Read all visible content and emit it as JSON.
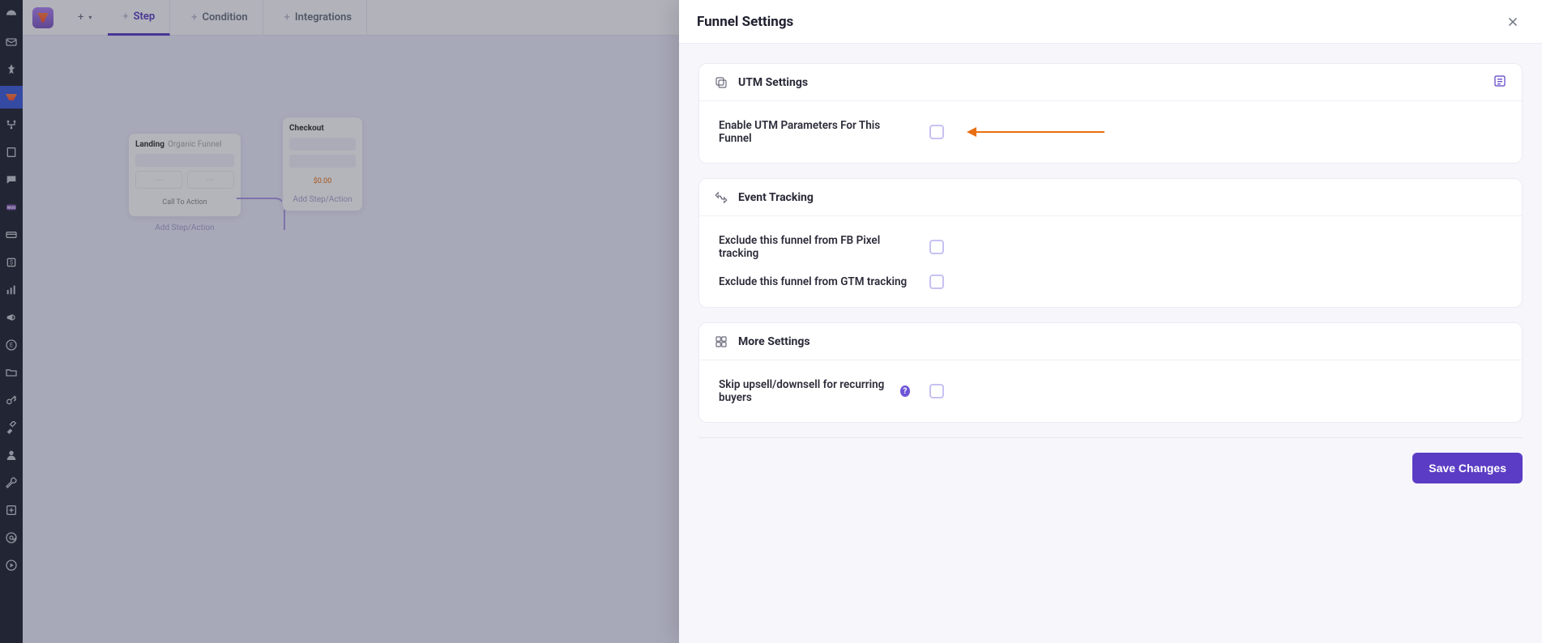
{
  "sidebar": {
    "items": [
      {
        "name": "dashboard-icon"
      },
      {
        "name": "mail-icon"
      },
      {
        "name": "pin-icon"
      },
      {
        "name": "funnel-icon",
        "active": true
      },
      {
        "name": "flow-icon"
      },
      {
        "name": "page-icon"
      },
      {
        "name": "chat-icon"
      },
      {
        "name": "woo-icon"
      },
      {
        "name": "card-icon"
      },
      {
        "name": "dollar-icon"
      },
      {
        "name": "barchart-icon"
      },
      {
        "name": "megaphone-icon"
      },
      {
        "name": "element-icon"
      },
      {
        "name": "folder-icon"
      },
      {
        "name": "key-icon"
      },
      {
        "name": "brush-icon"
      },
      {
        "name": "person-icon"
      },
      {
        "name": "wrench-icon"
      },
      {
        "name": "plus-box-icon"
      },
      {
        "name": "at-icon"
      },
      {
        "name": "play-icon"
      }
    ]
  },
  "topbar": {
    "add_label": "+",
    "tabs": [
      {
        "plus": "+",
        "label": "Step",
        "active": true
      },
      {
        "plus": "+",
        "label": "Condition",
        "active": false
      },
      {
        "plus": "+",
        "label": "Integrations",
        "active": false
      }
    ]
  },
  "canvas": {
    "node1": {
      "title": "Landing",
      "subtitle": "Organic Funnel",
      "cta": "Call To Action",
      "add_step": "Add Step/Action"
    },
    "node2": {
      "title": "Checkout",
      "add_step": "Add Step/Action",
      "price_prefix": "$0",
      "price_suffix": ".00"
    }
  },
  "drawer": {
    "title": "Funnel Settings",
    "sections": {
      "utm": {
        "title": "UTM Settings",
        "enable_label": "Enable UTM Parameters For This Funnel"
      },
      "event": {
        "title": "Event Tracking",
        "fb_label": "Exclude this funnel from FB Pixel tracking",
        "gtm_label": "Exclude this funnel from GTM tracking"
      },
      "more": {
        "title": "More Settings",
        "skip_label": "Skip upsell/downsell for recurring buyers",
        "help_glyph": "?"
      }
    },
    "save_label": "Save Changes"
  }
}
